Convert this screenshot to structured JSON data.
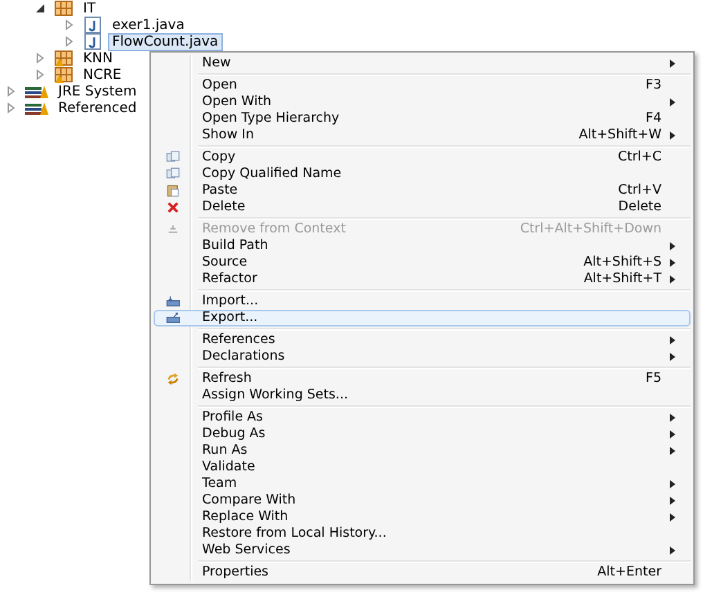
{
  "tree": {
    "offscreen_parent_children": [
      {
        "label": "IT",
        "kind": "package",
        "expanded": true,
        "children": [
          {
            "label": "exer1.java",
            "kind": "java",
            "expanded": false,
            "selected": false
          },
          {
            "label": "FlowCount.java",
            "kind": "java",
            "expanded": false,
            "selected": true
          }
        ]
      },
      {
        "label": "KNN",
        "kind": "package-empty",
        "expanded": false
      },
      {
        "label": "NCRE",
        "kind": "package-empty",
        "expanded": false
      }
    ],
    "items": [
      {
        "label": "JRE System",
        "kind": "library",
        "expanded": false
      },
      {
        "label": "Referenced",
        "kind": "library",
        "expanded": false
      }
    ]
  },
  "context_menu": [
    {
      "kind": "item",
      "label": "New",
      "submenu": true,
      "disabled": false,
      "selected": false
    },
    {
      "kind": "separator"
    },
    {
      "kind": "item",
      "label": "Open",
      "shortcut": "F3",
      "submenu": false,
      "disabled": false,
      "selected": false
    },
    {
      "kind": "item",
      "label": "Open With",
      "submenu": true,
      "disabled": false,
      "selected": false
    },
    {
      "kind": "item",
      "label": "Open Type Hierarchy",
      "shortcut": "F4",
      "submenu": false,
      "disabled": false,
      "selected": false
    },
    {
      "kind": "item",
      "label": "Show In",
      "shortcut": "Alt+Shift+W",
      "submenu": true,
      "disabled": false,
      "selected": false
    },
    {
      "kind": "separator"
    },
    {
      "kind": "copy",
      "label": "Copy",
      "shortcut": "Ctrl+C",
      "submenu": false,
      "disabled": false,
      "selected": false
    },
    {
      "kind": "copy",
      "label": "Copy Qualified Name",
      "submenu": false,
      "disabled": false,
      "selected": false
    },
    {
      "kind": "paste",
      "label": "Paste",
      "shortcut": "Ctrl+V",
      "submenu": false,
      "disabled": false,
      "selected": false
    },
    {
      "kind": "delete",
      "label": "Delete",
      "shortcut": "Delete",
      "submenu": false,
      "disabled": false,
      "selected": false
    },
    {
      "kind": "separator"
    },
    {
      "kind": "remove",
      "label": "Remove from Context",
      "shortcut": "Ctrl+Alt+Shift+Down",
      "submenu": false,
      "disabled": true,
      "selected": false
    },
    {
      "kind": "item",
      "label": "Build Path",
      "submenu": true,
      "disabled": false,
      "selected": false
    },
    {
      "kind": "item",
      "label": "Source",
      "shortcut": "Alt+Shift+S",
      "submenu": true,
      "disabled": false,
      "selected": false
    },
    {
      "kind": "item",
      "label": "Refactor",
      "shortcut": "Alt+Shift+T",
      "submenu": true,
      "disabled": false,
      "selected": false
    },
    {
      "kind": "separator"
    },
    {
      "kind": "import",
      "label": "Import...",
      "submenu": false,
      "disabled": false,
      "selected": false
    },
    {
      "kind": "export",
      "label": "Export...",
      "submenu": false,
      "disabled": false,
      "selected": true
    },
    {
      "kind": "separator"
    },
    {
      "kind": "item",
      "label": "References",
      "submenu": true,
      "disabled": false,
      "selected": false
    },
    {
      "kind": "item",
      "label": "Declarations",
      "submenu": true,
      "disabled": false,
      "selected": false
    },
    {
      "kind": "separator"
    },
    {
      "kind": "refresh",
      "label": "Refresh",
      "shortcut": "F5",
      "submenu": false,
      "disabled": false,
      "selected": false
    },
    {
      "kind": "item",
      "label": "Assign Working Sets...",
      "submenu": false,
      "disabled": false,
      "selected": false
    },
    {
      "kind": "separator"
    },
    {
      "kind": "item",
      "label": "Profile As",
      "submenu": true,
      "disabled": false,
      "selected": false
    },
    {
      "kind": "item",
      "label": "Debug As",
      "submenu": true,
      "disabled": false,
      "selected": false
    },
    {
      "kind": "item",
      "label": "Run As",
      "submenu": true,
      "disabled": false,
      "selected": false
    },
    {
      "kind": "item",
      "label": "Validate",
      "submenu": false,
      "disabled": false,
      "selected": false
    },
    {
      "kind": "item",
      "label": "Team",
      "submenu": true,
      "disabled": false,
      "selected": false
    },
    {
      "kind": "item",
      "label": "Compare With",
      "submenu": true,
      "disabled": false,
      "selected": false
    },
    {
      "kind": "item",
      "label": "Replace With",
      "submenu": true,
      "disabled": false,
      "selected": false
    },
    {
      "kind": "item",
      "label": "Restore from Local History...",
      "submenu": false,
      "disabled": false,
      "selected": false
    },
    {
      "kind": "item",
      "label": "Web Services",
      "submenu": true,
      "disabled": false,
      "selected": false
    },
    {
      "kind": "separator"
    },
    {
      "kind": "item",
      "label": "Properties",
      "shortcut": "Alt+Enter",
      "submenu": false,
      "disabled": false,
      "selected": false
    }
  ]
}
